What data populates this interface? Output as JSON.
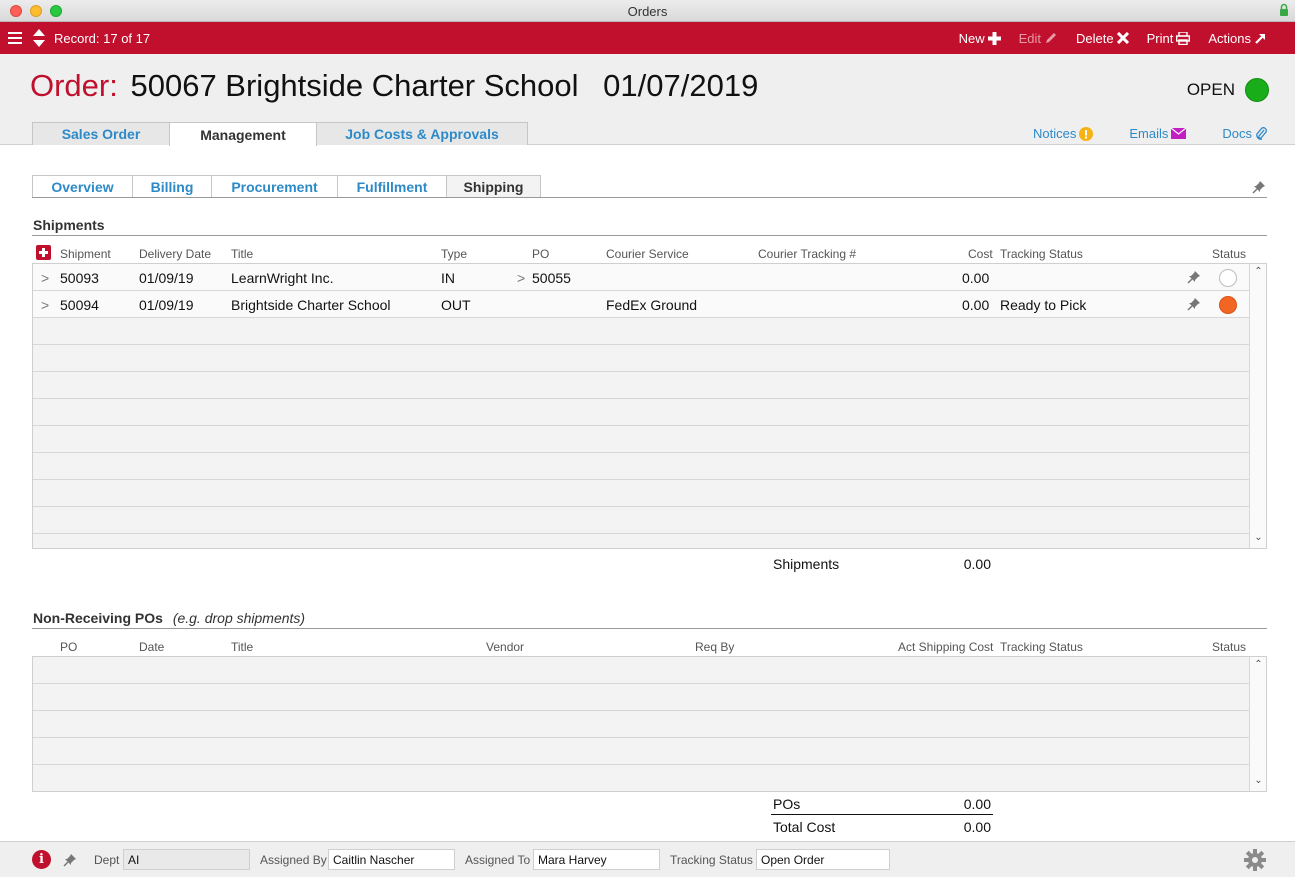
{
  "window": {
    "title": "Orders"
  },
  "toolbar": {
    "record": "Record: 17 of 17",
    "new_label": "New",
    "edit_label": "Edit",
    "delete_label": "Delete",
    "print_label": "Print",
    "actions_label": "Actions"
  },
  "header": {
    "order_label": "Order:",
    "order_number": "50067 Brightside Charter School",
    "order_date": "01/07/2019",
    "status": "OPEN",
    "status_color": "#19ad19",
    "tabs": [
      "Sales Order",
      "Management",
      "Job Costs & Approvals"
    ],
    "active_tab": "Management",
    "links": {
      "notices": "Notices",
      "emails": "Emails",
      "docs": "Docs"
    }
  },
  "subtabs": {
    "items": [
      "Overview",
      "Billing",
      "Procurement",
      "Fulfillment",
      "Shipping"
    ],
    "active": "Shipping"
  },
  "shipments": {
    "title": "Shipments",
    "columns": [
      "Shipment",
      "Delivery Date",
      "Title",
      "Type",
      "PO",
      "Courier Service",
      "Courier Tracking #",
      "Cost",
      "Tracking Status",
      "Status"
    ],
    "rows": [
      {
        "shipment": "50093",
        "delivery_date": "01/09/19",
        "title": "LearnWright Inc.",
        "type": "IN",
        "po": "50055",
        "courier_service": "",
        "tracking_no": "",
        "cost": "0.00",
        "tracking_status": "",
        "status_color": "#ffffff"
      },
      {
        "shipment": "50094",
        "delivery_date": "01/09/19",
        "title": "Brightside Charter School",
        "type": "OUT",
        "po": "",
        "courier_service": "FedEx Ground",
        "tracking_no": "",
        "cost": "0.00",
        "tracking_status": "Ready to Pick",
        "status_color": "#f26522"
      }
    ],
    "total_label": "Shipments",
    "total_value": "0.00"
  },
  "non_receiving": {
    "title": "Non-Receiving POs",
    "subtitle": "(e.g. drop shipments)",
    "columns": [
      "PO",
      "Date",
      "Title",
      "Vendor",
      "Req By",
      "Act Shipping Cost",
      "Tracking Status",
      "Status"
    ],
    "pos_label": "POs",
    "pos_value": "0.00",
    "total_cost_label": "Total Cost",
    "total_cost_value": "0.00"
  },
  "footer": {
    "dept_label": "Dept",
    "dept_value": "AI",
    "assigned_by_label": "Assigned By",
    "assigned_by_value": "Caitlin Nascher",
    "assigned_to_label": "Assigned To",
    "assigned_to_value": "Mara Harvey",
    "tracking_status_label": "Tracking Status",
    "tracking_status_value": "Open Order"
  }
}
